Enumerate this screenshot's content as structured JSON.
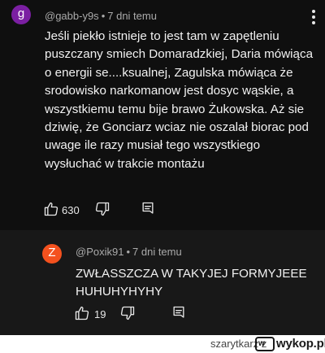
{
  "comments": [
    {
      "avatar_letter": "g",
      "avatar_color": "#7b1fa2",
      "author": "@gabb-y9s",
      "separator": "•",
      "time": "7 dni temu",
      "text": "Jeśli piekło istnieje to jest tam w zapętleniu puszczany smiech Domaradzkiej, Daria mówiąca o energii se....ksualnej, Zagulska mówiąca że srodowisko narkomanow jest dosyc wąskie, a wszystkiemu temu bije brawo Żukowska. Aż sie dziwię, że Gonciarz wciaz nie oszalał biorac pod uwage ile razy musiał tego wszystkiego wysłuchać w trakcie montażu",
      "likes": "630",
      "icons": {
        "like": "thumb-up-icon",
        "dislike": "thumb-down-icon",
        "reply": "reply-icon",
        "menu": "more-vertical-icon"
      }
    },
    {
      "avatar_letter": "Z",
      "avatar_color": "#f4511e",
      "author": "@Poxik91",
      "separator": "•",
      "time": "7 dni temu",
      "text": "ZWŁASSZCZA W TAKYJEJ FORMYJEEE HUHUHYHYHY",
      "likes": "19",
      "icons": {
        "like": "thumb-up-icon",
        "dislike": "thumb-down-icon",
        "reply": "reply-icon"
      }
    }
  ],
  "footer": {
    "username": "szarytkarz",
    "separator": "z",
    "site_badge": "w",
    "site_name": "wykop.pl"
  },
  "colors": {
    "background": "#0f0f0f",
    "reply_background": "#181818",
    "text": "#f1f1f1",
    "meta_text": "#aaaaaa"
  }
}
